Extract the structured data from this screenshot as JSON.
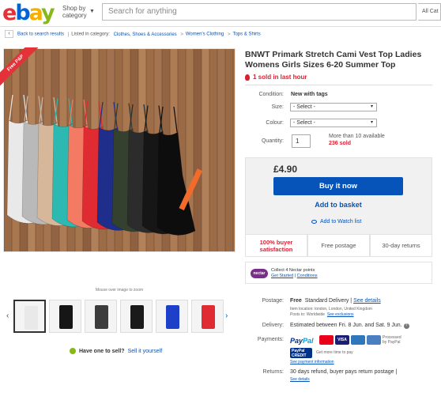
{
  "header": {
    "logo": "ebay",
    "shop_by_line1": "Shop by",
    "shop_by_line2": "category",
    "search_placeholder": "Search for anything",
    "all_categories": "All Cat"
  },
  "breadcrumb": {
    "back": "Back to search results",
    "listed_in": "Listed in category:",
    "items": [
      "Clothes, Shoes & Accessories",
      "Women's Clothing",
      "Tops & Shirts"
    ]
  },
  "image": {
    "ribbon": "Free P&P",
    "zoom_hint": "Mouse over image to zoom",
    "colors": [
      "#e9e9e9",
      "#b9b9b9",
      "#d7b79a",
      "#2bb9b1",
      "#f37a63",
      "#e02b33",
      "#1e2e8a",
      "#35412f",
      "#2c2c2c",
      "#161616",
      "#0d0d0d"
    ],
    "thumbnails": [
      "#e9e9e9",
      "#161616",
      "#3c3c3c",
      "#1a1a1a",
      "#1e3fc8",
      "#e02b33"
    ]
  },
  "sell": {
    "question": "Have one to sell?",
    "link": "Sell it yourself"
  },
  "item": {
    "title": "BNWT Primark Stretch Cami Vest Top Ladies Womens Girls Sizes 6-20 Summer Top",
    "sold_hour": "1 sold in last hour",
    "condition_label": "Condition:",
    "condition_value": "New with tags",
    "size_label": "Size:",
    "size_value": "- Select -",
    "colour_label": "Colour:",
    "colour_value": "- Select -",
    "quantity_label": "Quantity:",
    "quantity_value": "1",
    "available": "More than 10 available",
    "sold_count": "236 sold",
    "price": "£4.90",
    "buy_now": "Buy it now",
    "add_basket": "Add to basket",
    "watch_list": "Add to Watch list"
  },
  "features": {
    "f1_line1": "100% buyer",
    "f1_line2": "satisfaction",
    "f2": "Free postage",
    "f3": "30-day returns"
  },
  "nectar": {
    "logo": "nectar",
    "line1": "Collect 4 Nectar points",
    "get_started": "Get Started",
    "sep": "|",
    "conditions": "Conditions"
  },
  "postage": {
    "label": "Postage:",
    "free": "Free",
    "standard": "Standard Delivery",
    "sep": "|",
    "see_details": "See details",
    "location": "Item location: london, London, United Kingdom",
    "posts_to": "Posts to: Worldwide",
    "see_exclusions": "See exclusions"
  },
  "delivery": {
    "label": "Delivery:",
    "estimate": "Estimated between Fri. 8 Jun. and Sat. 9 Jun."
  },
  "payments": {
    "label": "Payments:",
    "paypal_a": "Pay",
    "paypal_b": "Pal",
    "cards": [
      "",
      "VISA",
      "",
      ""
    ],
    "processed": "Processed",
    "by_paypal": "by PayPal",
    "credit_a": "PayPal",
    "credit_b": "CREDIT",
    "more_time": "Get more time to pay",
    "see_info": "See payment information"
  },
  "returns": {
    "label": "Returns:",
    "text": "30 days refund, buyer pays return postage",
    "sep": "|",
    "see_details": "See details"
  }
}
